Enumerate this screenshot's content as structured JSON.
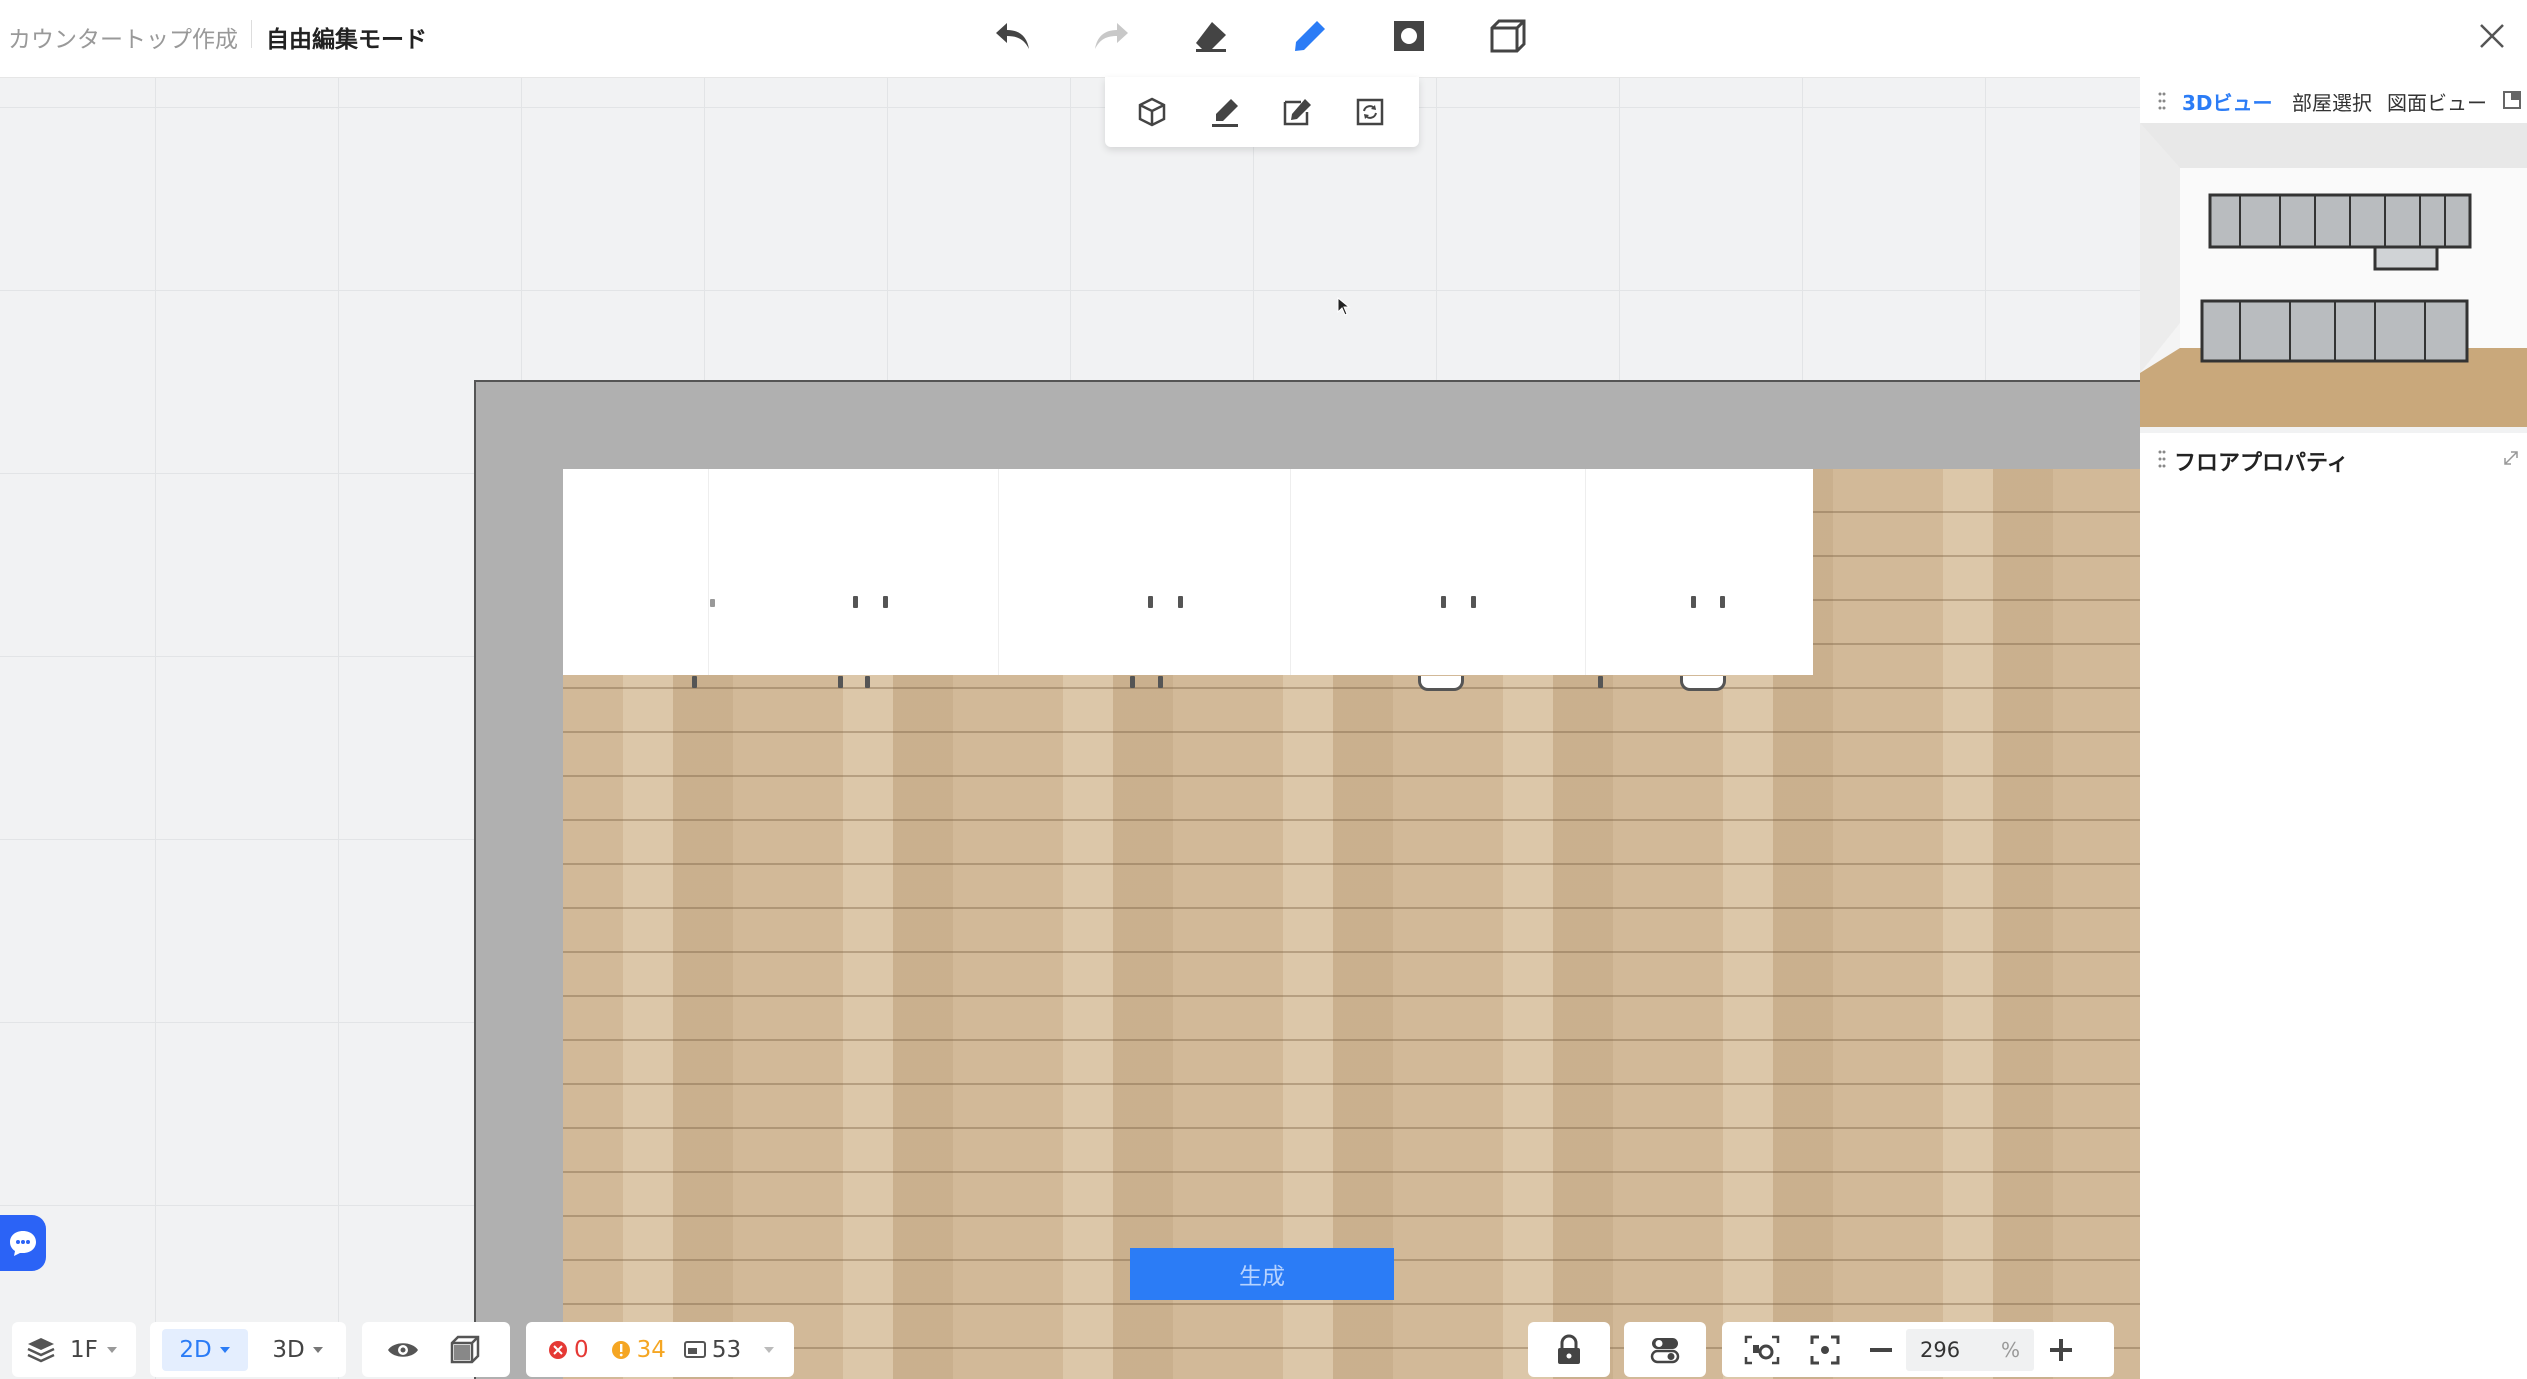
{
  "header": {
    "breadcrumb_parent": "カウンタートップ作成",
    "breadcrumb_current": "自由編集モード",
    "tools": [
      "undo-icon",
      "redo-icon",
      "eraser-icon",
      "pencil-icon",
      "rectangle-icon",
      "box-icon"
    ],
    "close": "close-icon"
  },
  "subtoolbar": {
    "tools": [
      "cube-icon",
      "brush-icon",
      "edit-area-icon",
      "refresh-icon"
    ]
  },
  "canvas": {
    "generate_label": "生成"
  },
  "preview_panel": {
    "tabs": [
      "3Dビュー",
      "部屋選択",
      "図面ビュー"
    ],
    "active_tab": "3Dビュー"
  },
  "floor_panel": {
    "title": "フロアプロパティ"
  },
  "bottombar": {
    "floor": "1F",
    "view_2d": "2D",
    "view_3d": "3D",
    "errors": "0",
    "warnings": "34",
    "items": "53",
    "zoom": "296",
    "zoom_unit": "%"
  },
  "colors": {
    "accent": "#2b7cf6",
    "error": "#e53935",
    "warning": "#f5a623"
  }
}
